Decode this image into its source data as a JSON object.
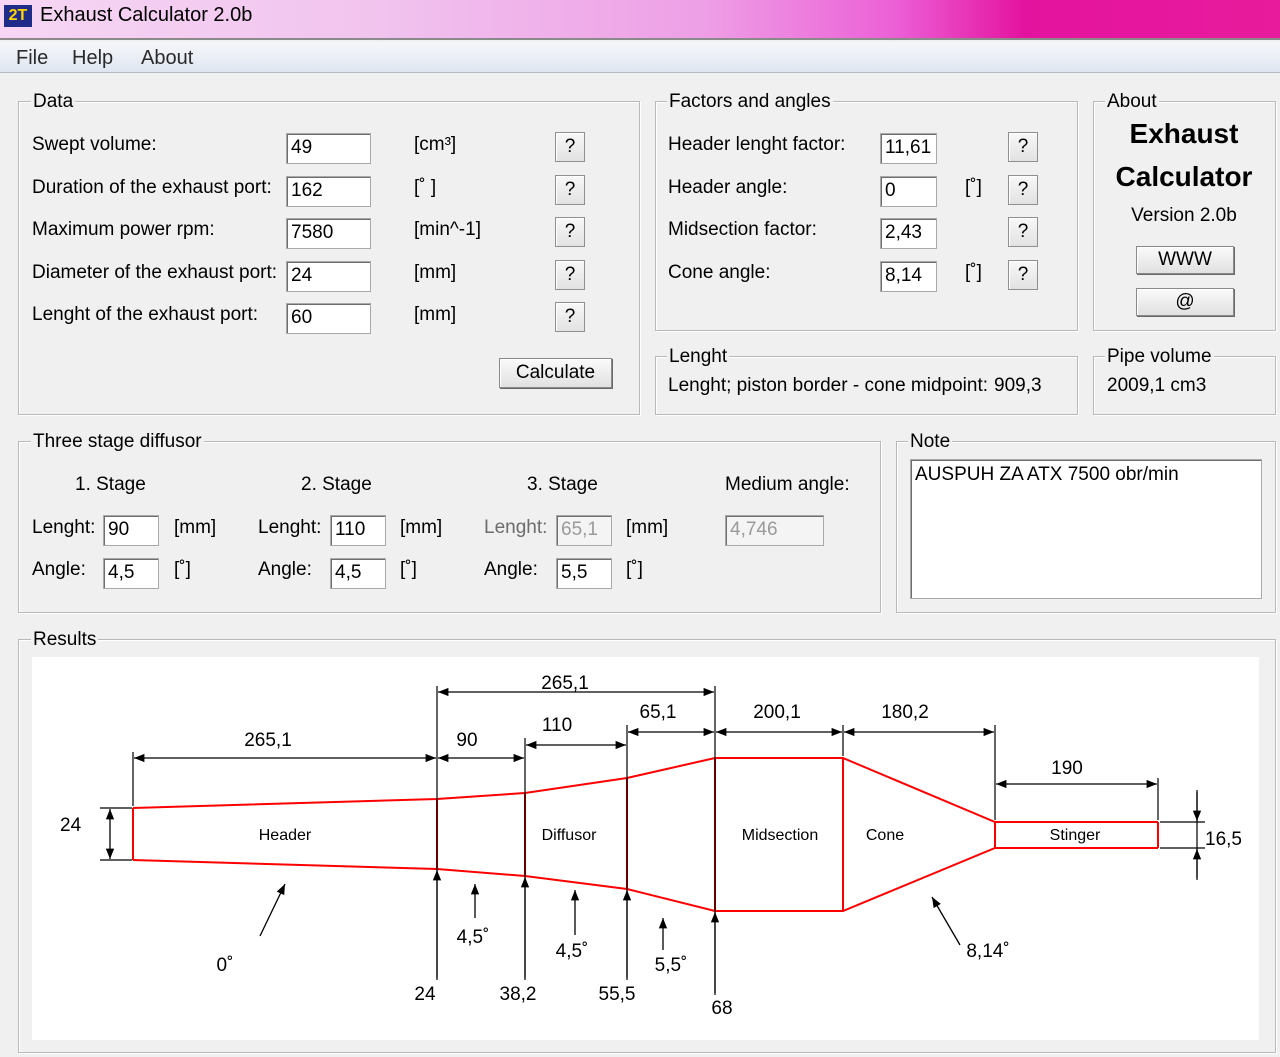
{
  "window": {
    "title": "Exhaust Calculator 2.0b",
    "icon_label": "2T"
  },
  "menu": [
    "File",
    "Help",
    "About"
  ],
  "data_group": {
    "title": "Data",
    "rows": [
      {
        "label": "Swept volume:",
        "value": "49",
        "unit": "[cm³]"
      },
      {
        "label": "Duration of the exhaust port:",
        "value": "162",
        "unit": "[˚ ]"
      },
      {
        "label": "Maximum power rpm:",
        "value": "7580",
        "unit": "[min^-1]"
      },
      {
        "label": "Diameter of the exhaust port:",
        "value": "24",
        "unit": "[mm]"
      },
      {
        "label": "Lenght of the exhaust port:",
        "value": "60",
        "unit": "[mm]"
      }
    ],
    "help_label": "?",
    "calculate_label": "Calculate"
  },
  "factors_group": {
    "title": "Factors and angles",
    "rows": [
      {
        "label": "Header lenght factor:",
        "value": "11,61",
        "unit": ""
      },
      {
        "label": "Header angle:",
        "value": "0",
        "unit": "[˚]"
      },
      {
        "label": "Midsection factor:",
        "value": "2,43",
        "unit": ""
      },
      {
        "label": "Cone angle:",
        "value": "8,14",
        "unit": "[˚]"
      }
    ]
  },
  "about_group": {
    "title": "About",
    "line1": "Exhaust",
    "line2": "Calculator",
    "version": "Version 2.0b",
    "www_label": "WWW",
    "email_label": "@"
  },
  "length_group": {
    "title": "Lenght",
    "text": "Lenght; piston border - cone midpoint:",
    "value": "909,3"
  },
  "pipe_volume_group": {
    "title": "Pipe volume",
    "value": "2009,1 cm3"
  },
  "diffusor_group": {
    "title": "Three stage diffusor",
    "stages": [
      {
        "title": "1. Stage",
        "length": "90",
        "angle": "4,5"
      },
      {
        "title": "2. Stage",
        "length": "110",
        "angle": "4,5"
      },
      {
        "title": "3. Stage",
        "length": "65,1",
        "angle": "5,5"
      }
    ],
    "length_label": "Lenght:",
    "angle_label": "Angle:",
    "length_unit": "[mm]",
    "angle_unit": "[˚]",
    "medium_angle_label": "Medium angle:",
    "medium_angle_value": "4,746"
  },
  "note_group": {
    "title": "Note",
    "text": "AUSPUH ZA ATX   7500 obr/min"
  },
  "results_group": {
    "title": "Results",
    "sections": [
      "Header",
      "Diffusor",
      "Midsection",
      "Cone",
      "Stinger"
    ],
    "lengths": {
      "header": "265,1",
      "diffusor_total": "265,1",
      "stage1": "90",
      "stage2": "110",
      "stage3": "65,1",
      "midsection": "200,1",
      "cone": "180,2",
      "stinger": "190"
    },
    "inlet_diameter": "24",
    "stinger_diameter": "16,5",
    "diameters": [
      "24",
      "38,2",
      "55,5",
      "68"
    ],
    "angles": {
      "header": "0˚",
      "stage1": "4,5˚",
      "stage2": "4,5˚",
      "stage3": "5,5˚",
      "cone": "8,14˚"
    },
    "line_color": "#ff0000"
  }
}
